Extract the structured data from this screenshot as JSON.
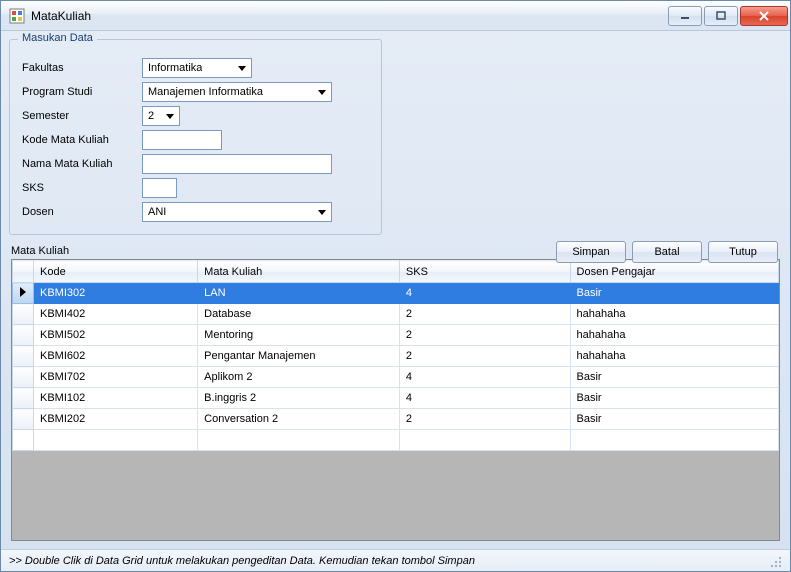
{
  "window": {
    "title": "MataKuliah"
  },
  "group": {
    "legend": "Masukan Data",
    "fields": {
      "fakultas_label": "Fakultas",
      "fakultas_value": "Informatika",
      "prodi_label": "Program Studi",
      "prodi_value": "Manajemen Informatika",
      "semester_label": "Semester",
      "semester_value": "2",
      "kode_label": "Kode Mata Kuliah",
      "kode_value": "",
      "nama_label": "Nama Mata Kuliah",
      "nama_value": "",
      "sks_label": "SKS",
      "sks_value": "",
      "dosen_label": "Dosen",
      "dosen_value": "ANI"
    }
  },
  "actions": {
    "simpan": "Simpan",
    "batal": "Batal",
    "tutup": "Tutup"
  },
  "grid": {
    "title": "Mata Kuliah",
    "headers": {
      "kode": "Kode",
      "mk": "Mata Kuliah",
      "sks": "SKS",
      "dosen": "Dosen Pengajar"
    },
    "rows": [
      {
        "kode": "KBMI302",
        "mk": "LAN",
        "sks": "4",
        "dosen": "Basir",
        "selected": true
      },
      {
        "kode": "KBMI402",
        "mk": "Database",
        "sks": "2",
        "dosen": "hahahaha"
      },
      {
        "kode": "KBMI502",
        "mk": "Mentoring",
        "sks": "2",
        "dosen": "hahahaha"
      },
      {
        "kode": "KBMI602",
        "mk": "Pengantar Manajemen",
        "sks": "2",
        "dosen": "hahahaha"
      },
      {
        "kode": "KBMI702",
        "mk": "Aplikom 2",
        "sks": "4",
        "dosen": "Basir"
      },
      {
        "kode": "KBMI102",
        "mk": "B.inggris 2",
        "sks": "4",
        "dosen": "Basir"
      },
      {
        "kode": "KBMI202",
        "mk": "Conversation 2",
        "sks": "2",
        "dosen": "Basir"
      }
    ]
  },
  "status": {
    "text": ">> Double Clik di Data Grid untuk melakukan pengeditan Data. Kemudian tekan tombol Simpan"
  }
}
